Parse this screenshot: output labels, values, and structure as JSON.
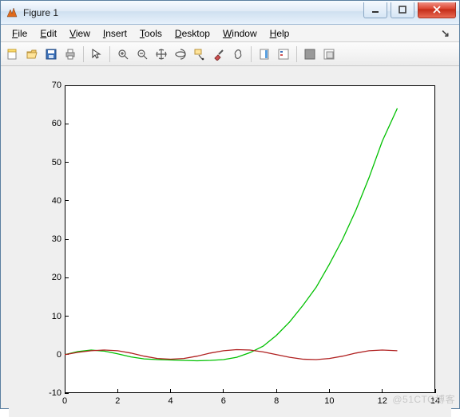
{
  "window": {
    "title": "Figure 1"
  },
  "menubar": {
    "items": [
      {
        "label": "File",
        "ul": "F"
      },
      {
        "label": "Edit",
        "ul": "E"
      },
      {
        "label": "View",
        "ul": "V"
      },
      {
        "label": "Insert",
        "ul": "I"
      },
      {
        "label": "Tools",
        "ul": "T"
      },
      {
        "label": "Desktop",
        "ul": "D"
      },
      {
        "label": "Window",
        "ul": "W"
      },
      {
        "label": "Help",
        "ul": "H"
      }
    ],
    "help_glyph": "↘"
  },
  "toolbar": {
    "groups": [
      [
        "new-figure-icon",
        "open-icon",
        "save-icon",
        "print-icon"
      ],
      [
        "pointer-icon"
      ],
      [
        "zoom-in-icon",
        "zoom-out-icon",
        "pan-icon",
        "rotate3d-icon",
        "data-cursor-icon",
        "brush-icon",
        "link-icon"
      ],
      [
        "colorbar-icon",
        "legend-icon"
      ],
      [
        "hide-plot-icon",
        "show-plot-icon"
      ]
    ]
  },
  "watermark": "@51CTO博客",
  "chart_data": {
    "type": "line",
    "xlabel": "",
    "ylabel": "",
    "xlim": [
      0,
      14
    ],
    "ylim": [
      -10,
      70
    ],
    "xticks": [
      0,
      2,
      4,
      6,
      8,
      10,
      12,
      14
    ],
    "yticks": [
      -10,
      0,
      10,
      20,
      30,
      40,
      50,
      60,
      70
    ],
    "series": [
      {
        "name": "series-1-green",
        "color": "#00c000",
        "x": [
          0,
          0.5,
          1,
          1.5,
          2,
          2.5,
          3,
          3.5,
          4,
          4.5,
          5,
          5.5,
          6,
          6.5,
          7,
          7.5,
          8,
          8.5,
          9,
          9.5,
          10,
          10.5,
          11,
          11.5,
          12,
          12.566
        ],
        "y": [
          0,
          0.8,
          1.2,
          0.9,
          0.2,
          -0.6,
          -1.1,
          -1.3,
          -1.4,
          -1.5,
          -1.6,
          -1.5,
          -1.3,
          -0.7,
          0.5,
          2.2,
          5.0,
          8.5,
          12.8,
          17.5,
          23.5,
          30.0,
          37.5,
          46.0,
          55.5,
          64.0
        ]
      },
      {
        "name": "series-2-red",
        "color": "#b02020",
        "x": [
          0,
          0.5,
          1,
          1.5,
          2,
          2.5,
          3,
          3.5,
          4,
          4.5,
          5,
          5.5,
          6,
          6.5,
          7,
          7.5,
          8,
          8.5,
          9,
          9.5,
          10,
          10.5,
          11,
          11.5,
          12,
          12.566
        ],
        "y": [
          0,
          0.6,
          1.0,
          1.2,
          1.0,
          0.4,
          -0.4,
          -1.0,
          -1.2,
          -1.0,
          -0.4,
          0.4,
          1.0,
          1.3,
          1.2,
          0.7,
          0.0,
          -0.7,
          -1.2,
          -1.3,
          -1.0,
          -0.4,
          0.4,
          1.0,
          1.2,
          1.0
        ]
      }
    ]
  }
}
